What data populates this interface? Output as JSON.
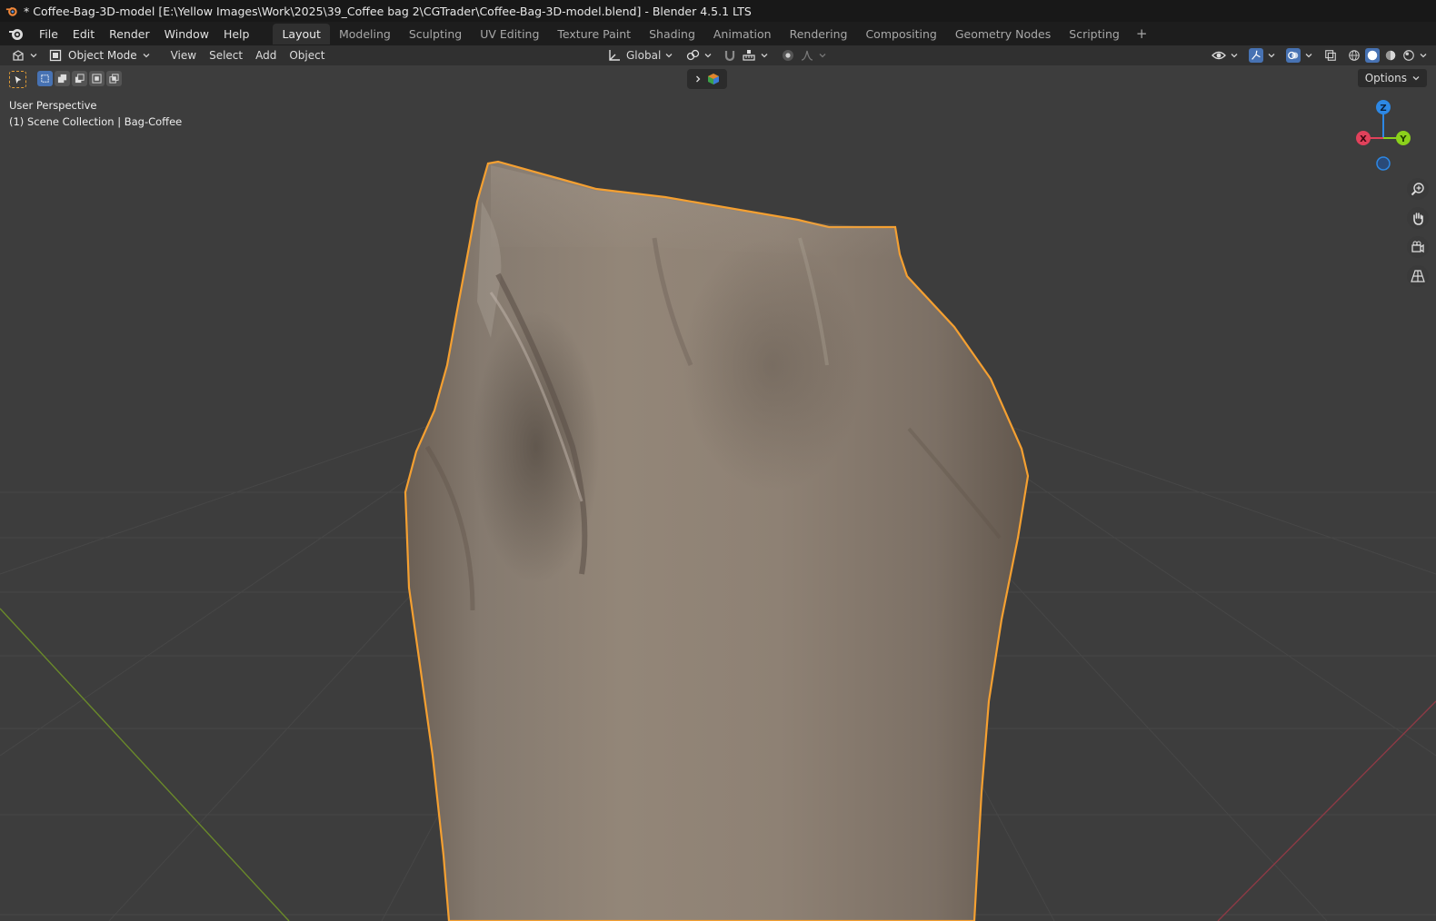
{
  "window": {
    "title": "* Coffee-Bag-3D-model [E:\\Yellow Images\\Work\\2025\\39_Coffee bag 2\\CGTrader\\Coffee-Bag-3D-model.blend] - Blender 4.5.1 LTS"
  },
  "menu": {
    "file": "File",
    "edit": "Edit",
    "render": "Render",
    "window": "Window",
    "help": "Help"
  },
  "workspaces": [
    {
      "label": "Layout",
      "active": true
    },
    {
      "label": "Modeling"
    },
    {
      "label": "Sculpting"
    },
    {
      "label": "UV Editing"
    },
    {
      "label": "Texture Paint"
    },
    {
      "label": "Shading"
    },
    {
      "label": "Animation"
    },
    {
      "label": "Rendering"
    },
    {
      "label": "Compositing"
    },
    {
      "label": "Geometry Nodes"
    },
    {
      "label": "Scripting"
    }
  ],
  "header": {
    "mode": "Object Mode",
    "view": "View",
    "select": "Select",
    "add": "Add",
    "object": "Object",
    "orientation": "Global"
  },
  "viewport": {
    "perspective_label": "User Perspective",
    "collection_label": "(1) Scene Collection | Bag-Coffee",
    "options_label": "Options",
    "gizmo": {
      "x": "X",
      "y": "Y",
      "z": "Z"
    }
  },
  "colors": {
    "accent": "#4772b3",
    "selection_outline": "#f5a031",
    "axis_x": "#e1415b",
    "axis_y": "#8bd11b",
    "axis_z": "#2d88e5"
  }
}
